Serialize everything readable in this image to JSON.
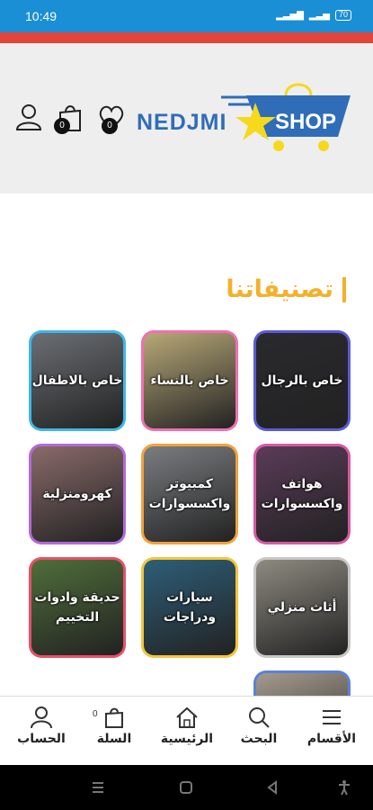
{
  "status": {
    "time": "10:49",
    "battery": "70"
  },
  "header": {
    "logo_text": "NEDJMI",
    "logo_shop": "SHOP",
    "wishlist_count": "0",
    "cart_count": "0",
    "colors": {
      "logo_blue": "#2f6db8",
      "star": "#f6d91a",
      "background": "#eeeeee"
    }
  },
  "section": {
    "title": "تصنيفاتنا"
  },
  "categories": [
    {
      "label": "خاص بالرجال",
      "bg": "#2a2a2e",
      "border": "#5b5bd6"
    },
    {
      "label": "خاص بالنساء",
      "bg": "#b9a978",
      "border": "#f06fb0"
    },
    {
      "label": "خاص بالاطفال",
      "bg": "#6b6f74",
      "border": "#3fb7e8"
    },
    {
      "label": "هواتف واكسسوارات",
      "bg": "#5a3b58",
      "border": "#d65aa4"
    },
    {
      "label": "كمبيوتر واكسسوارات",
      "bg": "#7a7d80",
      "border": "#f2a23c"
    },
    {
      "label": "كهرومنزلية",
      "bg": "#8a6a6a",
      "border": "#b36ad8"
    },
    {
      "label": "أثاث منزلي",
      "bg": "#8e8a80",
      "border": "#c7c7c7"
    },
    {
      "label": "سيارات ودراجات",
      "bg": "#2d5e78",
      "border": "#f4c53a"
    },
    {
      "label": "حديقة وادوات التخييم",
      "bg": "#4f6e3a",
      "border": "#e8506a"
    },
    {
      "label": "",
      "bg": "#a59b8e",
      "border": "#5b82d6"
    }
  ],
  "bottom_nav": {
    "categories": "الأقسام",
    "search": "البحث",
    "home": "الرئيسية",
    "cart": "السلة",
    "cart_count": "0",
    "account": "الحساب"
  }
}
